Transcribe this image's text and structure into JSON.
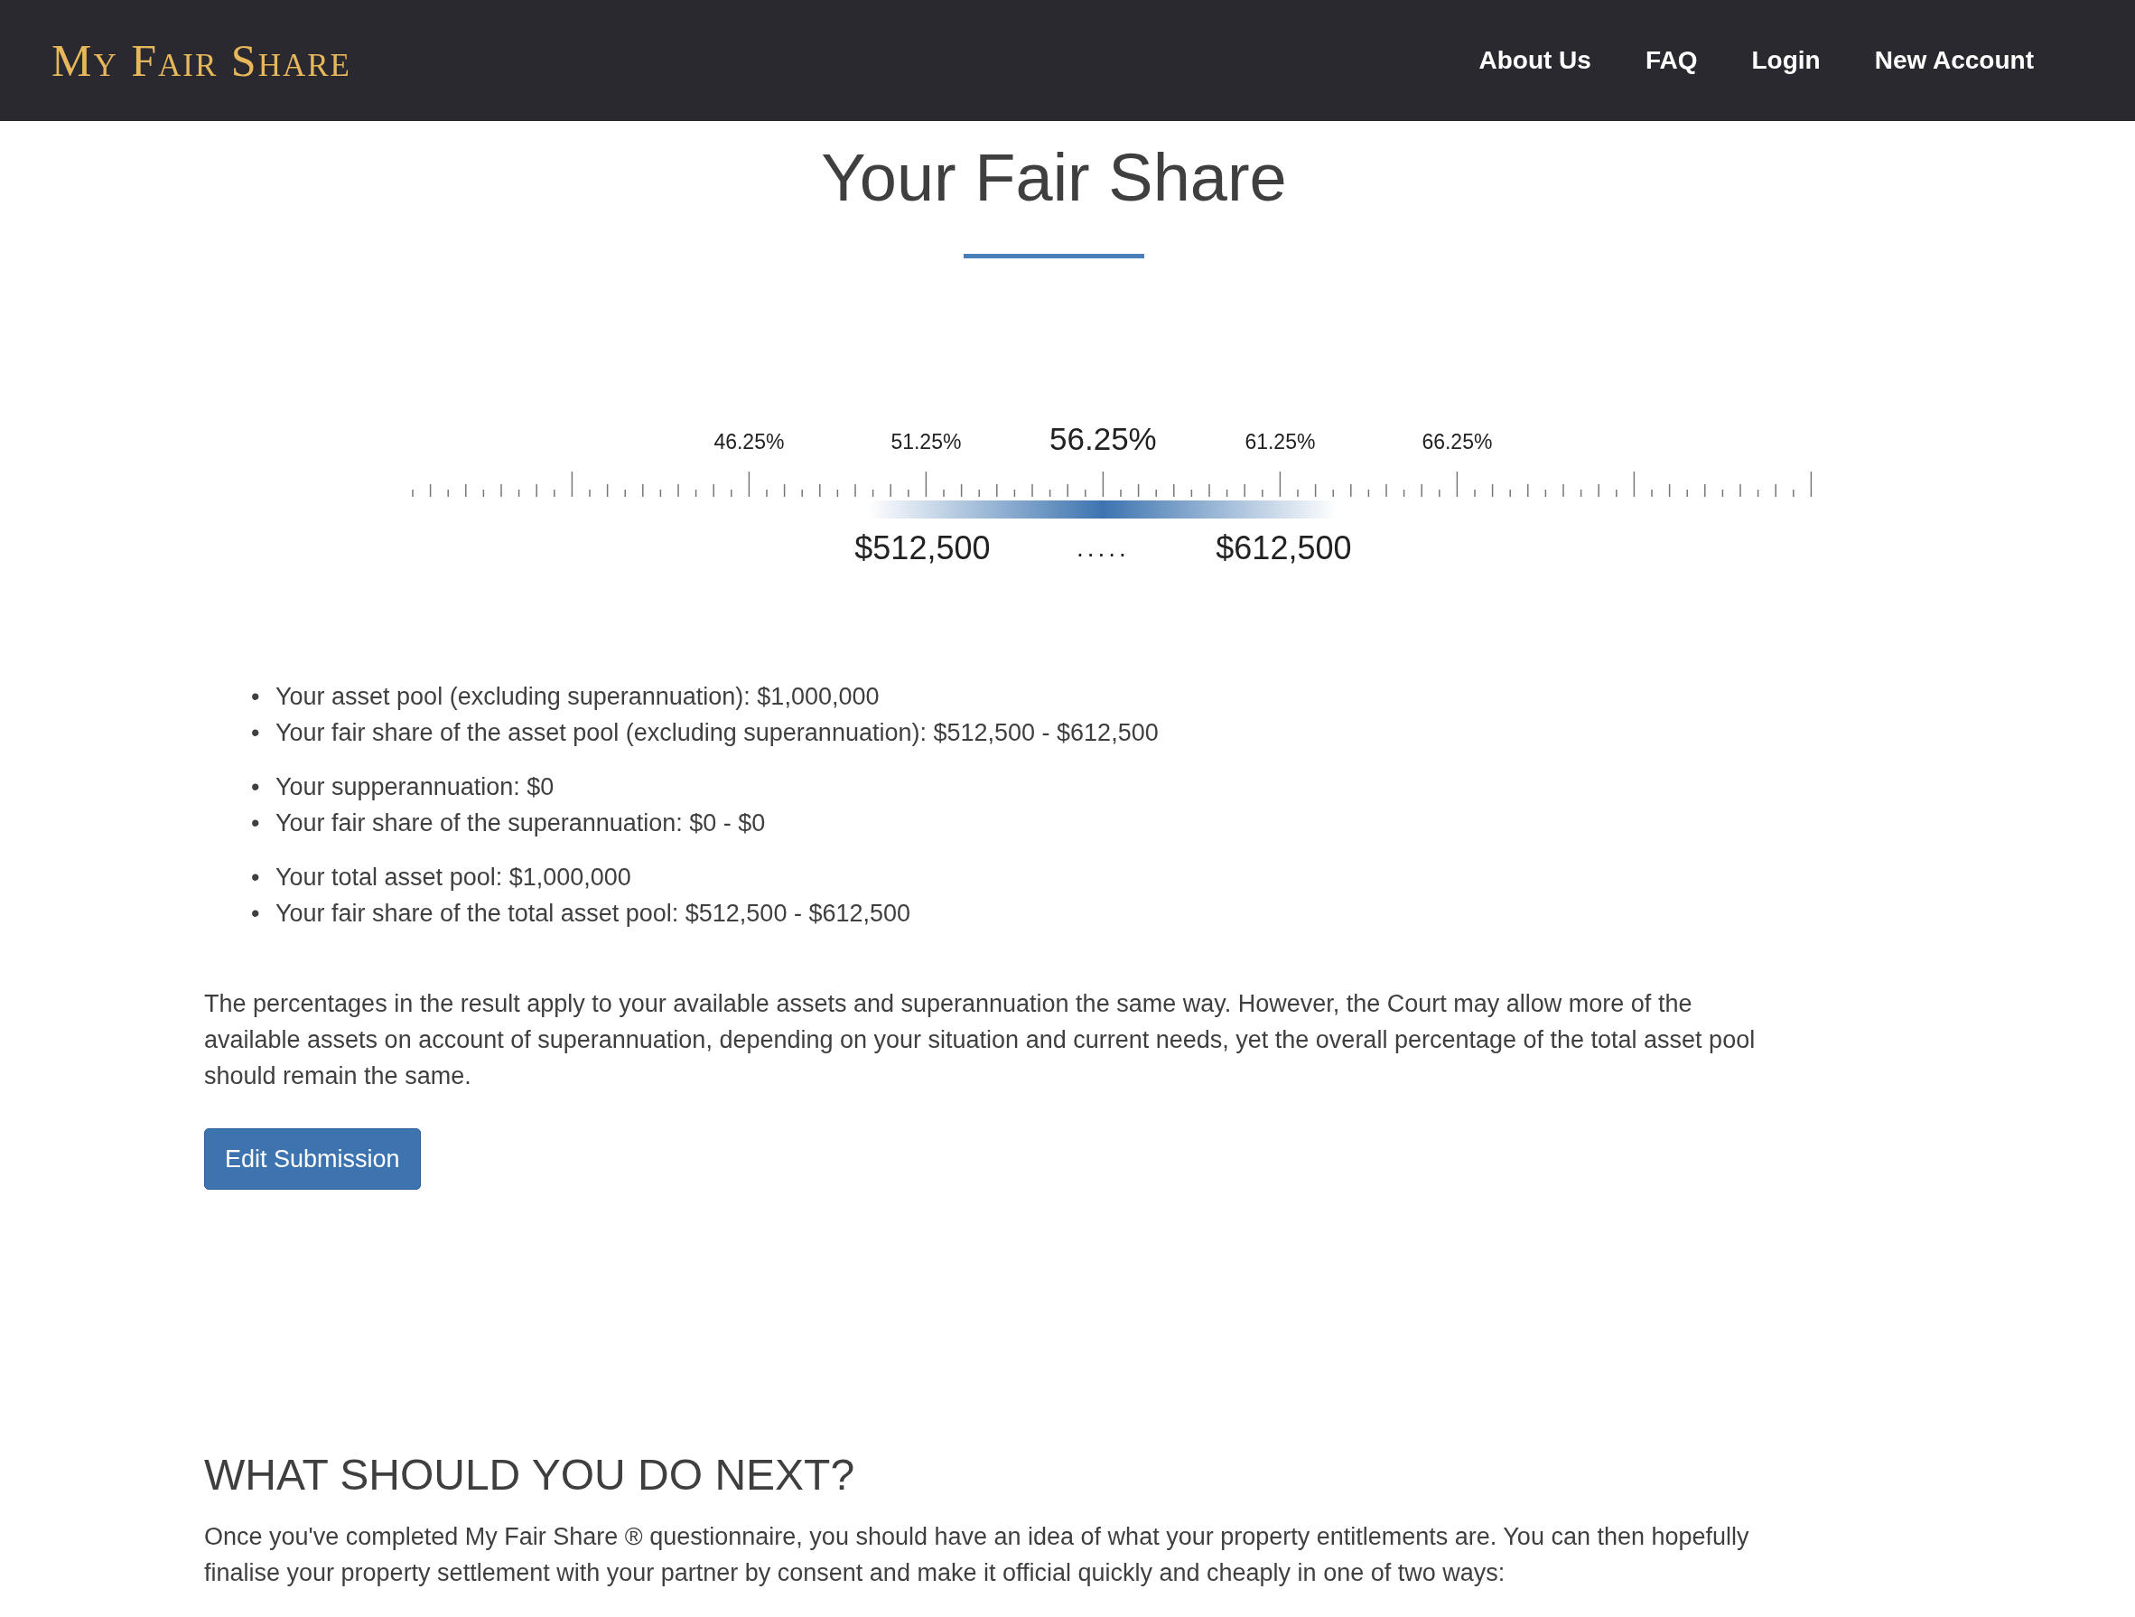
{
  "header": {
    "logo": "My Fair Share",
    "nav": [
      "About Us",
      "FAQ",
      "Login",
      "New Account"
    ]
  },
  "title": "Your Fair Share",
  "scale": {
    "tick_labels": [
      {
        "text": "46.25%",
        "emphasized": false
      },
      {
        "text": "51.25%",
        "emphasized": false
      },
      {
        "text": "56.25%",
        "emphasized": true
      },
      {
        "text": "61.25%",
        "emphasized": false
      },
      {
        "text": "66.25%",
        "emphasized": false
      }
    ],
    "range_low": "$512,500",
    "separator": ".....",
    "range_high": "$612,500"
  },
  "summary_groups": [
    [
      {
        "bullet": "•",
        "text": "Your asset pool (excluding superannuation): $1,000,000"
      },
      {
        "bullet": "•",
        "text": "Your fair share of the asset pool (excluding superannuation): $512,500 - $612,500"
      }
    ],
    [
      {
        "bullet": "•",
        "text": "Your supperannuation: $0"
      },
      {
        "bullet": "•",
        "text": "Your fair share of the superannuation: $0 - $0"
      }
    ],
    [
      {
        "bullet": "•",
        "text": "Your total asset pool: $1,000,000"
      },
      {
        "bullet": "•",
        "text": "Your fair share of the total asset pool: $512,500 - $612,500"
      }
    ]
  ],
  "note": "The percentages in the result apply to your available assets and superannuation the same way. However, the Court may allow more of the available assets on account of superannuation, depending on your situation and current needs, yet the overall percentage of the total asset pool should remain the same.",
  "edit_button": "Edit Submission",
  "next_heading": "WHAT SHOULD YOU DO NEXT?",
  "next_text": "Once you've completed My Fair Share ® questionnaire, you should have an idea of what your property entitlements are. You can then hopefully finalise your property settlement with your partner by consent and make it official quickly and cheaply in one of two ways:"
}
